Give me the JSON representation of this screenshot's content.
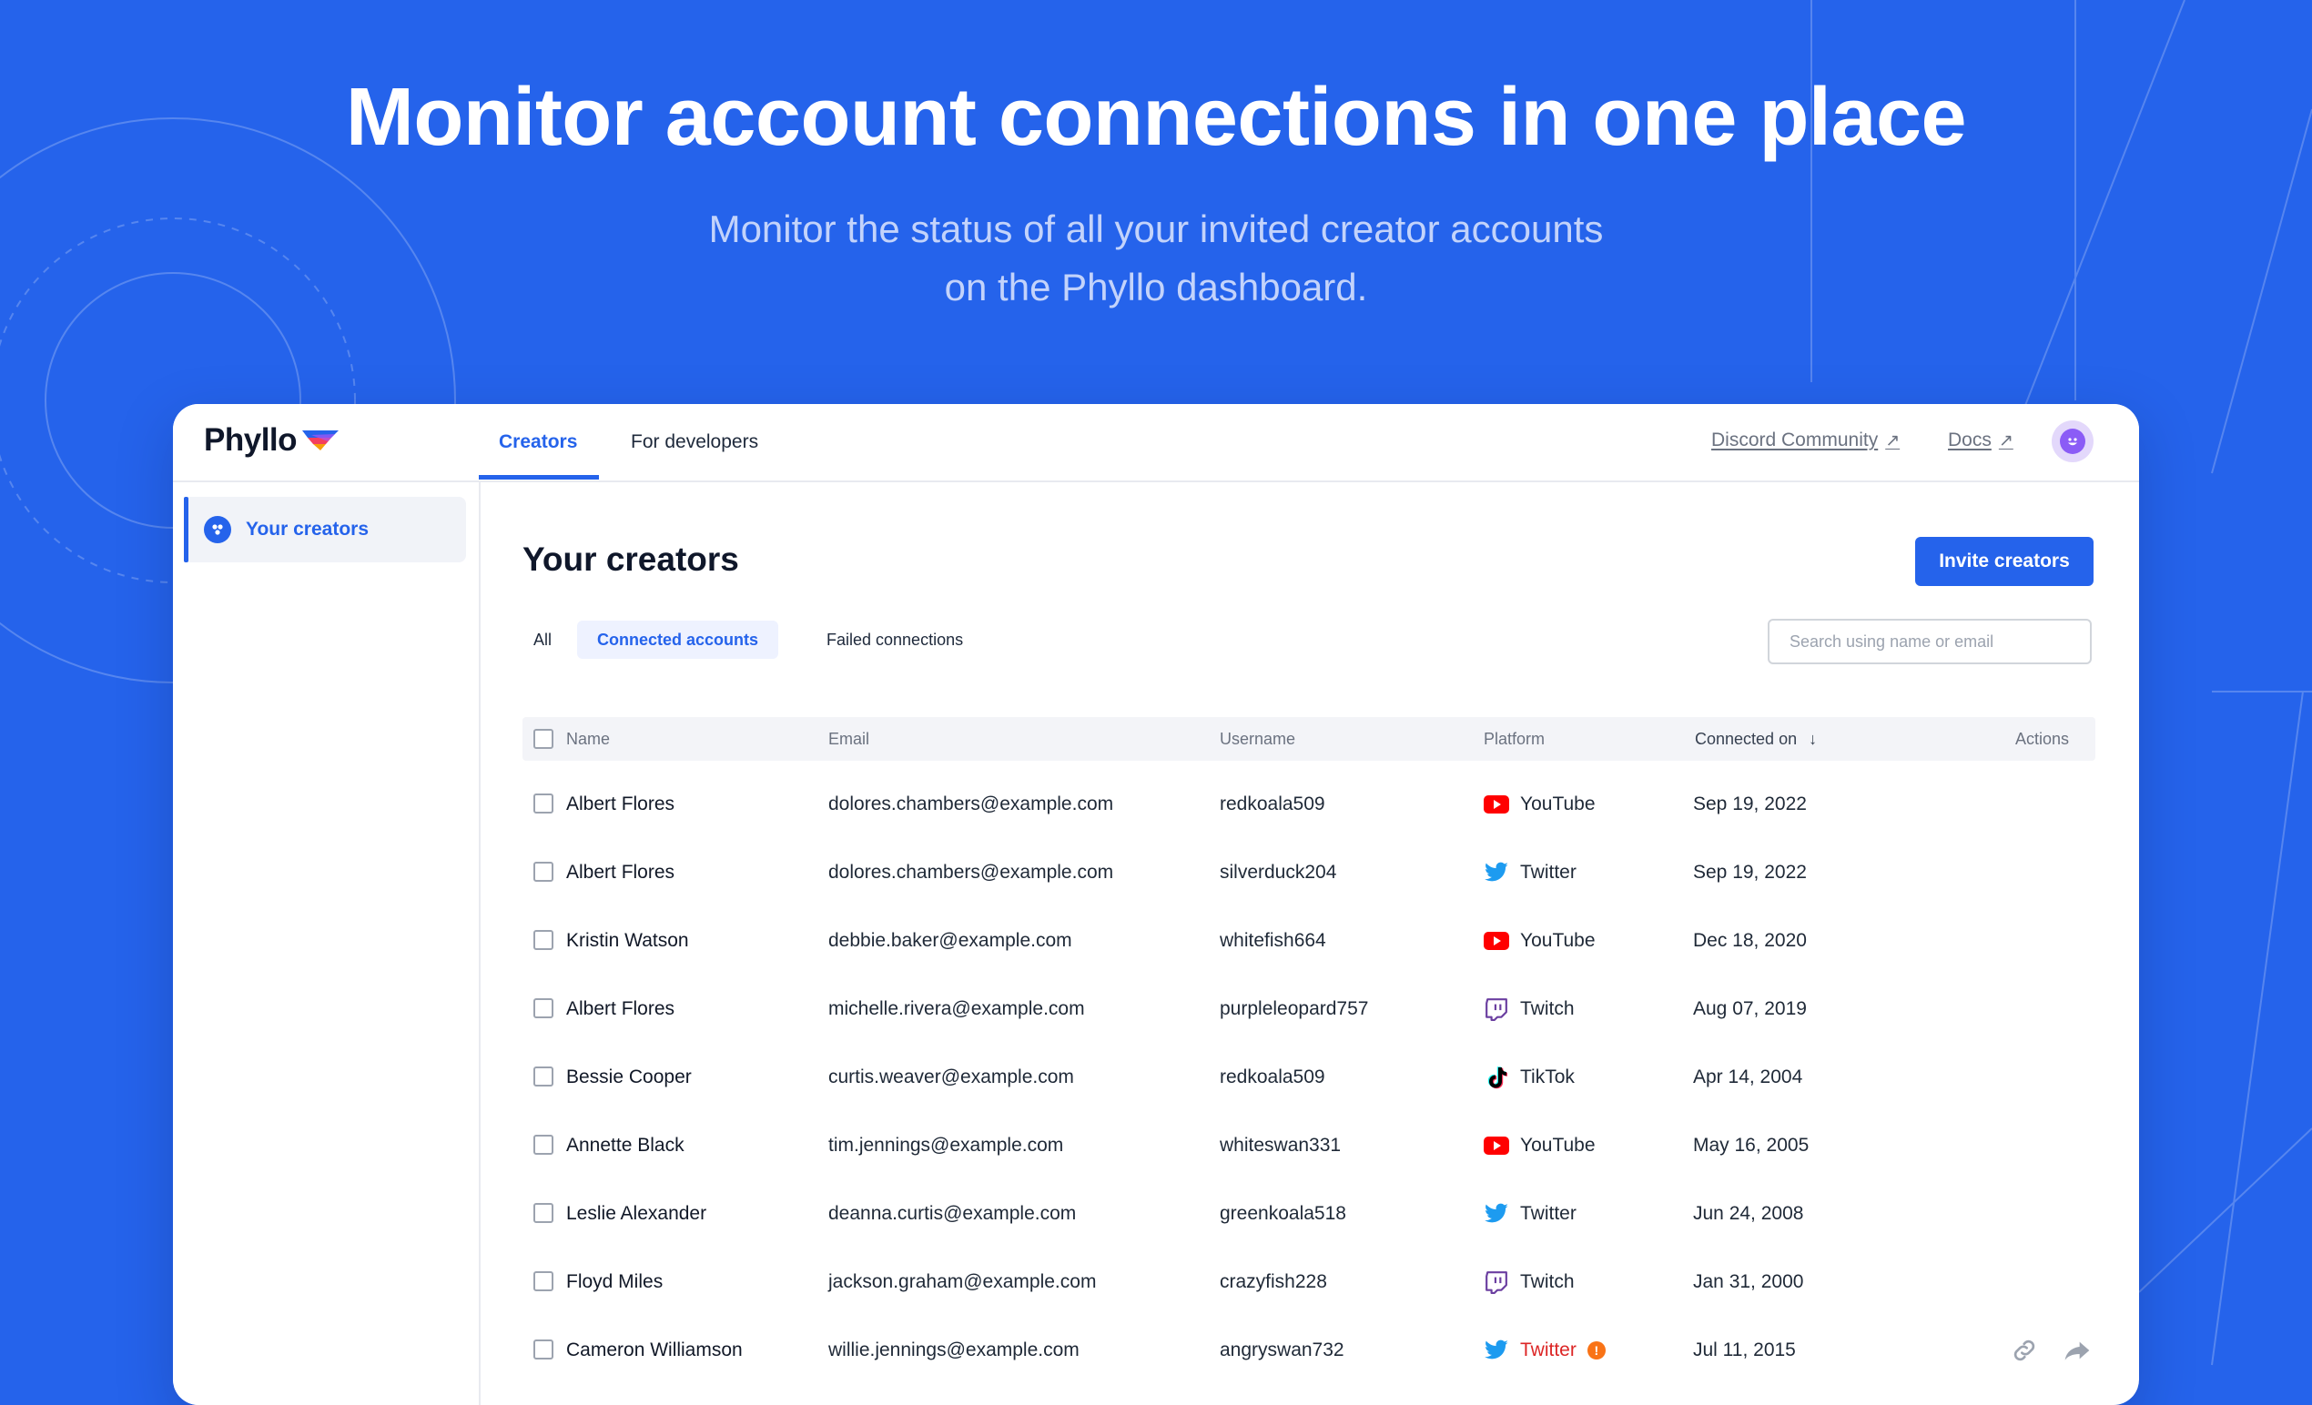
{
  "hero": {
    "title": "Monitor account connections in one place",
    "subtitle": "Monitor the status of all your invited creator accounts on the Phyllo dashboard."
  },
  "app": {
    "logo": "Phyllo",
    "nav": {
      "tabs": [
        "Creators",
        "For developers"
      ],
      "active": "Creators"
    },
    "links": {
      "discord": "Discord Community",
      "docs": "Docs"
    },
    "sidebar": {
      "items": [
        {
          "label": "Your creators",
          "icon": "users-icon",
          "active": true
        }
      ]
    },
    "page_title": "Your creators",
    "invite_button": "Invite creators",
    "filters": {
      "tabs": [
        "All",
        "Connected accounts",
        "Failed connections"
      ],
      "active": "Connected accounts"
    },
    "search": {
      "placeholder": "Search using name or email",
      "value": ""
    },
    "table": {
      "columns": [
        "Name",
        "Email",
        "Username",
        "Platform",
        "Connected on",
        "Actions"
      ],
      "sort": {
        "column": "Connected on",
        "direction": "desc"
      },
      "rows": [
        {
          "name": "Albert Flores",
          "email": "dolores.chambers@example.com",
          "username": "redkoala509",
          "platform": "YouTube",
          "date": "Sep 19, 2022"
        },
        {
          "name": "Albert Flores",
          "email": "dolores.chambers@example.com",
          "username": "silverduck204",
          "platform": "Twitter",
          "date": "Sep 19, 2022"
        },
        {
          "name": "Kristin Watson",
          "email": "debbie.baker@example.com",
          "username": "whitefish664",
          "platform": "YouTube",
          "date": "Dec 18, 2020"
        },
        {
          "name": "Albert Flores",
          "email": "michelle.rivera@example.com",
          "username": "purpleleopard757",
          "platform": "Twitch",
          "date": "Aug 07, 2019"
        },
        {
          "name": "Bessie Cooper",
          "email": "curtis.weaver@example.com",
          "username": "redkoala509",
          "platform": "TikTok",
          "date": "Apr 14, 2004"
        },
        {
          "name": "Annette Black",
          "email": "tim.jennings@example.com",
          "username": "whiteswan331",
          "platform": "YouTube",
          "date": "May 16, 2005"
        },
        {
          "name": "Leslie Alexander",
          "email": "deanna.curtis@example.com",
          "username": "greenkoala518",
          "platform": "Twitter",
          "date": "Jun 24, 2008"
        },
        {
          "name": "Floyd Miles",
          "email": "jackson.graham@example.com",
          "username": "crazyfish228",
          "platform": "Twitch",
          "date": "Jan 31, 2000"
        },
        {
          "name": "Cameron Williamson",
          "email": "willie.jennings@example.com",
          "username": "angryswan732",
          "platform": "Twitter",
          "date": "Jul 11, 2015",
          "failed": true,
          "actions": [
            "link-icon",
            "share-arrow-icon"
          ]
        }
      ]
    }
  },
  "colors": {
    "brand_blue": "#2563EB",
    "youtube": "#FF0000",
    "twitter": "#1D9BF0",
    "twitch": "#6B3FA0",
    "tiktok": "#000000",
    "error": "#DC2626",
    "warning": "#F97316"
  }
}
